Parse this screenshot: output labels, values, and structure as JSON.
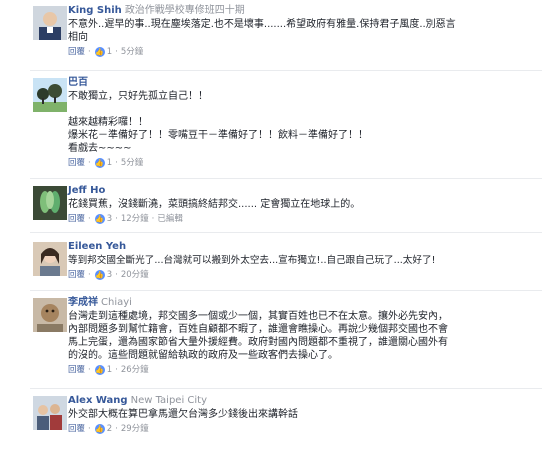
{
  "actions": {
    "reply": "回覆",
    "like": "讚",
    "dot": "·"
  },
  "comments": [
    {
      "name": "King Shih",
      "subtitle": "政治作戰學校專修班四十期",
      "lines": [
        "不意外..遲早的事..現在塵埃落定.也不是壞事.......希望政府有雅量.保持君子風度..別惡言",
        "相向"
      ],
      "likes": "1",
      "time": "5分鐘"
    },
    {
      "name": "巴百",
      "subtitle": "",
      "lines": [
        "不敢獨立，只好先孤立自己！！",
        "",
        "越來越精彩囉！！",
        "爆米花－準備好了！！零嘴豆干－準備好了！！飲料－準備好了！！",
        "看戲去~~~~"
      ],
      "likes": "1",
      "time": "5分鐘"
    },
    {
      "name": "Jeff Ho",
      "subtitle": "",
      "lines": [
        "花錢買蕉，沒錢斷澆，菜頭搞終結邦交...... 定會獨立在地球上的。"
      ],
      "likes": "3",
      "time": "12分鐘",
      "edited": "已編輯"
    },
    {
      "name": "Eileen Yeh",
      "subtitle": "",
      "lines": [
        "等到邦交國全斷光了...台灣就可以搬到外太空去...宣布獨立!..自己跟自己玩了...太好了!"
      ],
      "likes": "3",
      "time": "20分鐘"
    },
    {
      "name": "李成祥",
      "subtitle": "Chiayi",
      "lines": [
        "台灣走到這種處境，邦交國多一個或少一個，其實百姓也已不在太意。攘外必先安內，",
        "內部問題多到幫忙籍會，百姓自顧都不暇了，誰還會瞧操心。再說少幾個邦交國也不會",
        "馬上完蛋，還為國家節省大量外援經費。政府對國內問題都不重視了，誰還關心國外有",
        "的沒的。這些問題就留給執政的政府及一些政客們去操心了。"
      ],
      "likes": "1",
      "time": "26分鐘"
    },
    {
      "name": "Alex Wang",
      "subtitle": "New Taipei City",
      "lines": [
        "外交部大概在算巴拿馬還欠台灣多少錢後出來講幹話"
      ],
      "likes": "2",
      "time": "29分鐘"
    }
  ],
  "colors": {
    "link": "#365899",
    "meta": "#90949c",
    "like_badge": "#5890ff"
  }
}
